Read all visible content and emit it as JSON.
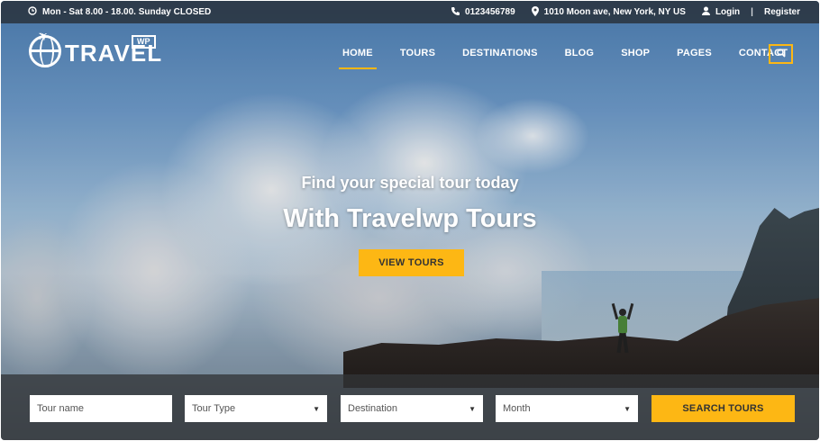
{
  "topbar": {
    "hours": "Mon - Sat 8.00 - 18.00. Sunday CLOSED",
    "phone": "0123456789",
    "address": "1010 Moon ave, New York, NY US",
    "login": "Login",
    "separator": "|",
    "register": "Register",
    "icons": [
      "clock-icon",
      "phone-icon",
      "map-marker-icon",
      "user-icon"
    ]
  },
  "logo": {
    "text": "TRAVEL",
    "badge": "WP"
  },
  "nav": {
    "items": [
      "HOME",
      "TOURS",
      "DESTINATIONS",
      "BLOG",
      "SHOP",
      "PAGES",
      "CONTACT"
    ],
    "active": "HOME",
    "search_icon": "search-icon"
  },
  "hero": {
    "subtitle": "Find your special tour today",
    "title": "With Travelwp Tours",
    "cta": "VIEW TOURS"
  },
  "search_form": {
    "tour_name_placeholder": "Tour name",
    "tour_type": "Tour Type",
    "destination": "Destination",
    "month": "Month",
    "submit": "SEARCH TOURS"
  },
  "colors": {
    "accent": "#fdb714",
    "topbar_bg": "#283038",
    "panel_bg": "#323437"
  }
}
